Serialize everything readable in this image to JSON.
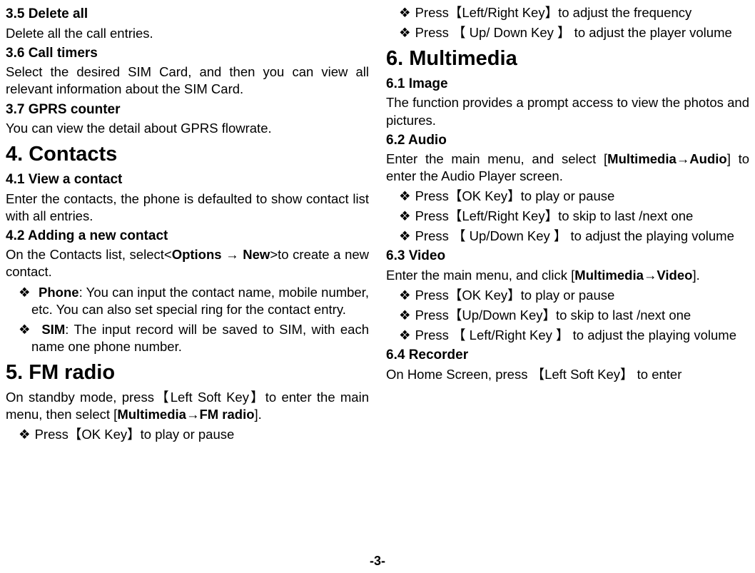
{
  "left": {
    "s35_title": "3.5 Delete all",
    "s35_body": "Delete all the call entries.",
    "s36_title": "3.6 Call timers",
    "s36_body": "Select the desired SIM Card, and then you can view all relevant information about the SIM Card.",
    "s37_title": "3.7 GPRS counter",
    "s37_body": "You can view the detail about GPRS flowrate.",
    "s4_title": "4. Contacts",
    "s41_title": "4.1 View a contact",
    "s41_body": "Enter the contacts, the phone is defaulted to show contact list with all entries.",
    "s42_title": "4.2 Adding a new contact",
    "s42_body_pre": "On the Contacts list, select<",
    "s42_body_b1": "Options",
    "s42_body_mid": " → ",
    "s42_body_b2": "New",
    "s42_body_post": ">to create a new contact.",
    "s42_li1_b": "Phone",
    "s42_li1_rest": ": You can input the contact name, mobile number, etc. You can also set special ring for the contact entry.",
    "s42_li2_b": "SIM",
    "s42_li2_rest": ": The input record will be saved to SIM, with each name one phone number.",
    "s5_title": "5. FM radio",
    "s5_body_pre": "On standby mode, press【Left Soft Key】to enter the main menu, then select [",
    "s5_body_b1": "Multimedia",
    "s5_body_mid": "→",
    "s5_body_b2": "FM radio",
    "s5_body_post": "].",
    "s5_li1": "Press【OK Key】to play or pause"
  },
  "right": {
    "fm_li2": "Press【Left/Right Key】to adjust the frequency",
    "fm_li3": "Press 【 Up/ Down Key 】 to adjust the player volume",
    "s6_title": "6. Multimedia",
    "s61_title": "6.1 Image",
    "s61_body": "The function provides a prompt access to view the photos and pictures.",
    "s62_title": "6.2 Audio",
    "s62_body_pre": "Enter the main menu, and select [",
    "s62_body_b1": "Multimedia",
    "s62_body_mid": "→",
    "s62_body_b2": "Audio",
    "s62_body_post": "] to enter the Audio Player screen.",
    "s62_li1": "Press【OK Key】to play or pause",
    "s62_li2": "Press【Left/Right Key】to skip to last /next one",
    "s62_li3": "Press 【 Up/Down Key 】 to adjust the playing volume",
    "s63_title": "6.3 Video",
    "s63_body_pre": "Enter the main menu, and click [",
    "s63_body_b1": "Multimedia",
    "s63_body_mid": "→",
    "s63_body_b2": "Video",
    "s63_body_post": "].",
    "s63_li1": "Press【OK Key】to play or pause",
    "s63_li2": "Press【Up/Down Key】to skip to last /next one",
    "s63_li3": "Press 【 Left/Right Key 】 to adjust the playing volume",
    "s64_title": "6.4 Recorder",
    "s64_body": "On Home Screen, press  【Left Soft Key】  to enter"
  },
  "pagenum": "-3-"
}
